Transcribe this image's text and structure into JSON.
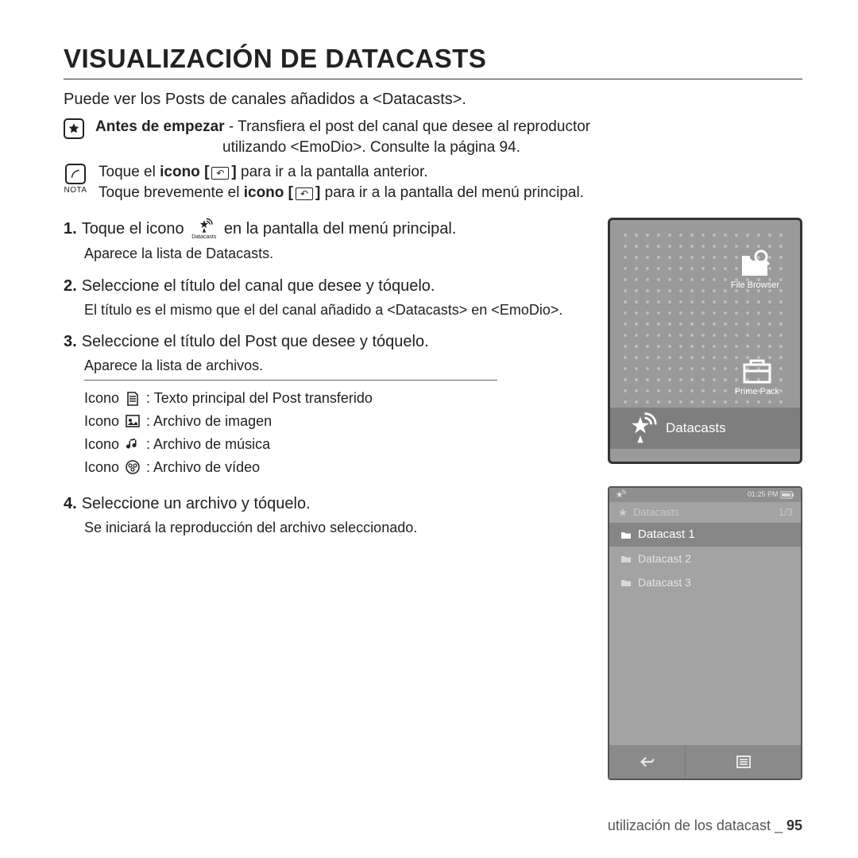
{
  "title": "VISUALIZACIÓN DE DATACASTS",
  "intro": "Puede ver los Posts de canales añadidos a <Datacasts>.",
  "before": {
    "label": "Antes de empezar",
    "text1": " - Transﬁera el post del canal que desee al reproductor",
    "text2": "utilizando <EmoDio>. Consulte la página 94."
  },
  "nota": {
    "label": "NOTA",
    "line1a": "Toque el ",
    "line1b": "icono [",
    "line1c": "]",
    "line1d": " para ir a la pantalla anterior.",
    "line2a": "Toque brevemente el ",
    "line2b": "icono [",
    "line2c": "]",
    "line2d": " para ir a la pantalla del menú principal."
  },
  "steps": {
    "s1": {
      "num": "1.",
      "a": "Toque el icono",
      "b": "en la pantalla del menú principal.",
      "sub": "Aparece la lista de Datacasts.",
      "iconlabel": "Datacasts"
    },
    "s2": {
      "num": "2.",
      "t": "Seleccione el título del canal que desee y tóquelo.",
      "sub": "El título es el mismo que el del canal añadido a <Datacasts> en <EmoDio>."
    },
    "s3": {
      "num": "3.",
      "t": "Seleccione el título del Post que desee y tóquelo.",
      "sub": "Aparece la lista de archivos."
    },
    "s4": {
      "num": "4.",
      "t": "Seleccione un archivo y tóquelo.",
      "sub": "Se iniciará la reproducción del archivo seleccionado."
    }
  },
  "icons": {
    "l1": "Icono",
    "d1": ": Texto principal del Post transferido",
    "l2": "Icono",
    "d2": ": Archivo de imagen",
    "l3": "Icono",
    "d3": ": Archivo de música",
    "l4": "Icono",
    "d4": ": Archivo de vídeo"
  },
  "phone1": {
    "filebrowser": "File Browser",
    "primepack": "Prime Pack",
    "datacasts": "Datacasts"
  },
  "phone2": {
    "time": "01:25 PM",
    "hdr": "Datacasts",
    "count": "1/3",
    "items": [
      "Datacast 1",
      "Datacast 2",
      "Datacast 3"
    ]
  },
  "footer": {
    "text": "utilización de los datacast _ ",
    "page": "95"
  }
}
